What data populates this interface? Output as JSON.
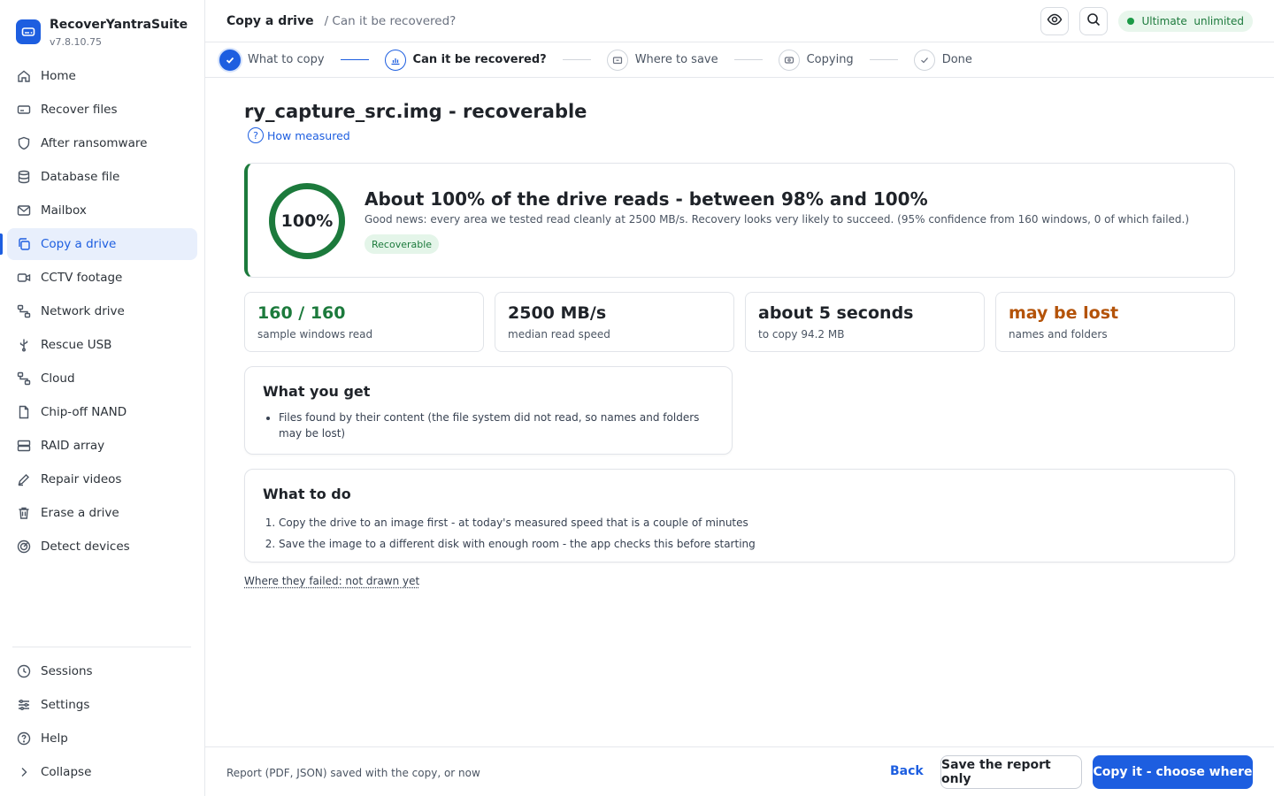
{
  "app": {
    "name": "RecoverYantraSuite",
    "version": "v7.8.10.75"
  },
  "sidebar": {
    "items": [
      {
        "label": "Home",
        "icon": "home-icon"
      },
      {
        "label": "Recover files",
        "icon": "drive-icon"
      },
      {
        "label": "After ransomware",
        "icon": "shield-icon"
      },
      {
        "label": "Database file",
        "icon": "database-icon"
      },
      {
        "label": "Mailbox",
        "icon": "mail-icon"
      },
      {
        "label": "Copy a drive",
        "icon": "copy-icon",
        "active": true
      },
      {
        "label": "CCTV footage",
        "icon": "camera-icon"
      },
      {
        "label": "Network drive",
        "icon": "network-icon"
      },
      {
        "label": "Rescue USB",
        "icon": "usb-icon"
      },
      {
        "label": "Cloud",
        "icon": "cloud-icon"
      },
      {
        "label": "Chip-off NAND",
        "icon": "file-icon"
      },
      {
        "label": "RAID array",
        "icon": "raid-icon"
      },
      {
        "label": "Repair videos",
        "icon": "pen-icon"
      },
      {
        "label": "Erase a drive",
        "icon": "trash-icon"
      },
      {
        "label": "Detect devices",
        "icon": "radar-icon"
      }
    ],
    "bottom": [
      {
        "label": "Sessions",
        "icon": "clock-icon"
      },
      {
        "label": "Settings",
        "icon": "sliders-icon"
      },
      {
        "label": "Help",
        "icon": "help-icon"
      },
      {
        "label": "Collapse",
        "icon": "chevron-right-icon"
      }
    ]
  },
  "header": {
    "crumb_main": "Copy a drive",
    "crumb_sub": "/ Can it be recovered?",
    "plan_label": "Ultimate  unlimited"
  },
  "stepper": {
    "steps": [
      {
        "label": "What to copy",
        "state": "done"
      },
      {
        "label": "Can it be recovered?",
        "state": "current"
      },
      {
        "label": "Where to save",
        "state": "todo"
      },
      {
        "label": "Copying",
        "state": "todo"
      },
      {
        "label": "Done",
        "state": "todo"
      }
    ]
  },
  "main": {
    "title": "ry_capture_src.img - recoverable",
    "how_measured": "How measured",
    "hero": {
      "percent_label": "100%",
      "percent_value": 100,
      "headline": "About 100% of the drive reads - between 98% and 100%",
      "description": "Good news: every area we tested read cleanly at 2500 MB/s. Recovery looks very likely to succeed. (95% confidence from 160 windows, 0 of which failed.)",
      "badge": "Recoverable",
      "accent": "#1c7a3c"
    },
    "stats": [
      {
        "value": "160 / 160",
        "label": "sample windows read",
        "color": "#1c7a3c"
      },
      {
        "value": "2500 MB/s",
        "label": "median read speed",
        "color": "#1f2329"
      },
      {
        "value": "about 5 seconds",
        "label": "to copy 94.2 MB",
        "color": "#1f2329"
      },
      {
        "value": "may be lost",
        "label": "names and folders",
        "color": "#b45309"
      }
    ],
    "what_you_get": {
      "title": "What you get",
      "items": [
        "Files found by their content (the file system did not read, so names and folders may be lost)"
      ]
    },
    "what_to_do": {
      "title": "What to do",
      "items": [
        "Copy the drive to an image first - at today's measured speed that is a couple of minutes",
        "Save the image to a different disk with enough room - the app checks this before starting"
      ]
    },
    "failed_link": "Where they failed: not drawn yet"
  },
  "footer": {
    "note": "Report (PDF, JSON) saved with the copy, or now",
    "back": "Back",
    "save_report": "Save the report only",
    "primary": "Copy it - choose where"
  }
}
